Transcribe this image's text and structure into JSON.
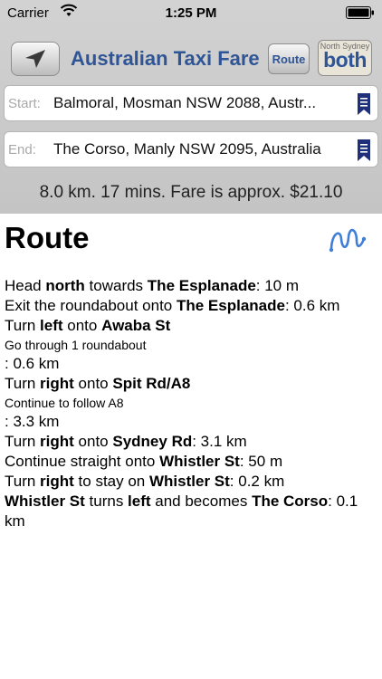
{
  "status_bar": {
    "carrier": "Carrier",
    "time": "1:25 PM"
  },
  "nav": {
    "title": "Australian Taxi Fare",
    "route_label": "Route",
    "map_top_label": "North Sydney",
    "map_label": "both"
  },
  "start": {
    "label": "Start:",
    "value": "Balmoral, Mosman NSW 2088, Austr..."
  },
  "end": {
    "label": "End:",
    "value": "The Corso, Manly NSW 2095, Australia"
  },
  "summary": "8.0 km. 17 mins. Fare is approx. $21.10",
  "route": {
    "heading": "Route",
    "steps": [
      {
        "kind": "step",
        "parts": [
          [
            "Head ",
            false
          ],
          [
            "north",
            true
          ],
          [
            " towards ",
            false
          ],
          [
            "The Esplanade",
            true
          ],
          [
            ": 10 m",
            false
          ]
        ]
      },
      {
        "kind": "step",
        "parts": [
          [
            "Exit the roundabout onto ",
            false
          ],
          [
            "The Esplanade",
            true
          ],
          [
            ": 0.6 km",
            false
          ]
        ]
      },
      {
        "kind": "step",
        "parts": [
          [
            "Turn ",
            false
          ],
          [
            "left",
            true
          ],
          [
            " onto ",
            false
          ],
          [
            "Awaba St",
            true
          ]
        ]
      },
      {
        "kind": "note",
        "parts": [
          [
            "Go through 1 roundabout",
            false
          ]
        ]
      },
      {
        "kind": "step",
        "parts": [
          [
            ": 0.6 km",
            false
          ]
        ]
      },
      {
        "kind": "step",
        "parts": [
          [
            "Turn ",
            false
          ],
          [
            "right",
            true
          ],
          [
            " onto ",
            false
          ],
          [
            "Spit Rd/A8",
            true
          ]
        ]
      },
      {
        "kind": "note",
        "parts": [
          [
            "Continue to follow A8",
            false
          ]
        ]
      },
      {
        "kind": "step",
        "parts": [
          [
            ": 3.3 km",
            false
          ]
        ]
      },
      {
        "kind": "step",
        "parts": [
          [
            "Turn ",
            false
          ],
          [
            "right",
            true
          ],
          [
            " onto ",
            false
          ],
          [
            "Sydney Rd",
            true
          ],
          [
            ": 3.1 km",
            false
          ]
        ]
      },
      {
        "kind": "step",
        "parts": [
          [
            "Continue straight onto ",
            false
          ],
          [
            "Whistler St",
            true
          ],
          [
            ": 50 m",
            false
          ]
        ]
      },
      {
        "kind": "step",
        "parts": [
          [
            "Turn ",
            false
          ],
          [
            "right",
            true
          ],
          [
            " to stay on ",
            false
          ],
          [
            "Whistler St",
            true
          ],
          [
            ": 0.2 km",
            false
          ]
        ]
      },
      {
        "kind": "step",
        "parts": [
          [
            "Whistler St",
            true
          ],
          [
            " turns ",
            false
          ],
          [
            "left",
            true
          ],
          [
            " and becomes ",
            false
          ],
          [
            "The Corso",
            true
          ],
          [
            ": 0.1 km",
            false
          ]
        ]
      }
    ]
  },
  "icons": {
    "wifi": "wifi-icon",
    "battery": "battery-icon",
    "locate": "location-arrow-icon",
    "bookmark": "bookmark-icon",
    "route": "route-squiggle-icon"
  },
  "colors": {
    "title_blue": "#2f5596",
    "route_icon": "#3f7fd8",
    "bookmark_navy": "#1f2f7a"
  }
}
